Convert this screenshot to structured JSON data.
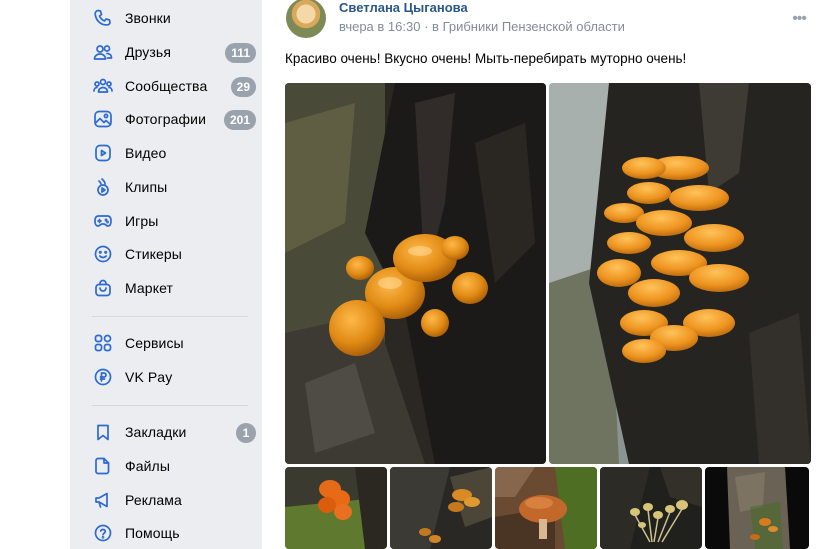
{
  "sidebar": {
    "items": [
      {
        "label": "Звонки",
        "icon": "phone-icon",
        "badge": ""
      },
      {
        "label": "Друзья",
        "icon": "friends-icon",
        "badge": "111"
      },
      {
        "label": "Сообщества",
        "icon": "communities-icon",
        "badge": "29"
      },
      {
        "label": "Фотографии",
        "icon": "photos-icon",
        "badge": "201"
      },
      {
        "label": "Видео",
        "icon": "video-icon",
        "badge": ""
      },
      {
        "label": "Клипы",
        "icon": "clips-icon",
        "badge": ""
      },
      {
        "label": "Игры",
        "icon": "games-icon",
        "badge": ""
      },
      {
        "label": "Стикеры",
        "icon": "stickers-icon",
        "badge": ""
      },
      {
        "label": "Маркет",
        "icon": "market-icon",
        "badge": ""
      },
      {
        "label": "Сервисы",
        "icon": "services-icon",
        "badge": ""
      },
      {
        "label": "VK Pay",
        "icon": "vkpay-icon",
        "badge": ""
      },
      {
        "label": "Закладки",
        "icon": "bookmark-icon",
        "badge": "1"
      },
      {
        "label": "Файлы",
        "icon": "files-icon",
        "badge": ""
      },
      {
        "label": "Реклама",
        "icon": "ads-icon",
        "badge": ""
      },
      {
        "label": "Помощь",
        "icon": "help-icon",
        "badge": ""
      }
    ]
  },
  "post": {
    "author": "Светлана Цыганова",
    "time": "вчера в 16:30",
    "separator": "·",
    "place": "в Грибники Пензенской области",
    "more": "•••",
    "text": "Красиво очень! Вкусно очень! Мыть-перебирать муторно очень!"
  },
  "colors": {
    "accent": "#2d6ad1",
    "link": "#2a5885",
    "badge": "#99a2ad",
    "sidebar_bg": "#ebedf0"
  }
}
